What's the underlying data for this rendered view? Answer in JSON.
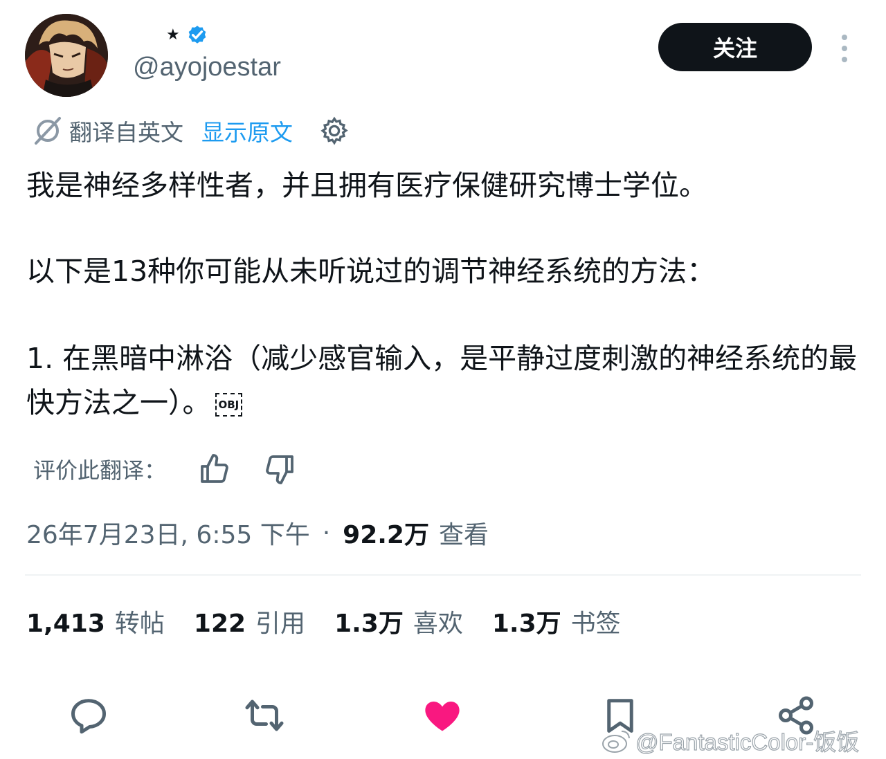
{
  "header": {
    "display_name_star": "★",
    "handle": "@ayojoestar",
    "follow_label": "关注"
  },
  "translation": {
    "translated_from": "翻译自英文",
    "show_original": "显示原文"
  },
  "body": {
    "paragraph1": "我是神经多样性者，并且拥有医疗保健研究博士学位。",
    "paragraph2": "以下是13种你可能从未听说过的调节神经系统的方法：",
    "paragraph3": "1. 在黑暗中淋浴（减少感官输入，是平静过度刺激的神经系统的最快方法之一）。",
    "obj_marker": "OBJ"
  },
  "rate": {
    "label": "评价此翻译："
  },
  "meta": {
    "timestamp": "26年7月23日, 6:55 下午",
    "separator": "·",
    "views": "92.2万",
    "views_label": "查看"
  },
  "stats": [
    {
      "num": "1,413",
      "label": "转帖"
    },
    {
      "num": "122",
      "label": "引用"
    },
    {
      "num": "1.3万",
      "label": "喜欢"
    },
    {
      "num": "1.3万",
      "label": "书签"
    }
  ],
  "colors": {
    "accent": "#1d9bf0",
    "like": "#f91880",
    "text": "#0f1419",
    "muted": "#536471"
  },
  "watermark": "@FantasticColor-饭饭"
}
